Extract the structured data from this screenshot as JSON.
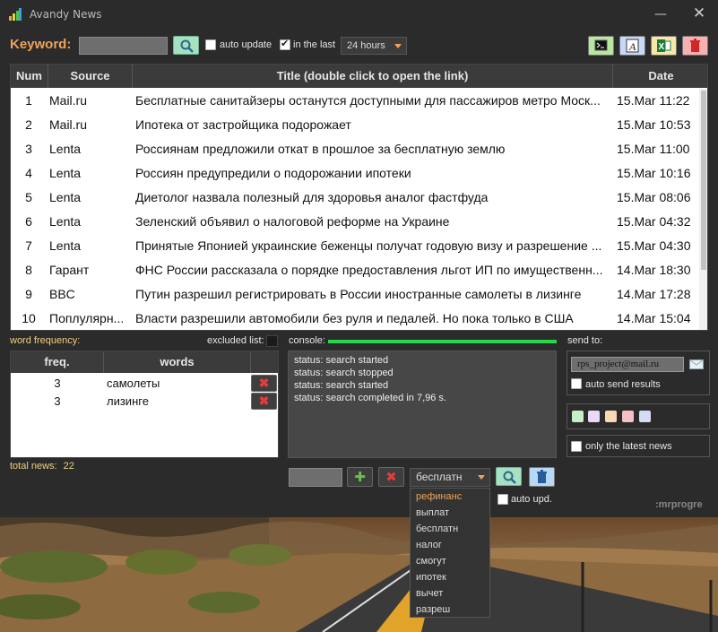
{
  "window": {
    "title": "Avandy News"
  },
  "toolbar": {
    "keyword_label": "Keyword:",
    "keyword_value": "",
    "auto_update_label": "auto update",
    "auto_update_checked": false,
    "in_last_label": "in the last",
    "in_last_checked": true,
    "period": "24 hours",
    "buttons": [
      "console-icon",
      "font-icon",
      "excel-icon",
      "trash-icon"
    ]
  },
  "news": {
    "columns": [
      "Num",
      "Source",
      "Title (double click to open the link)",
      "Date"
    ],
    "rows": [
      {
        "num": "1",
        "source": "Mail.ru",
        "title": "Бесплатные санитайзеры останутся доступными для пассажиров метро Моск...",
        "date": "15.Mar 11:22"
      },
      {
        "num": "2",
        "source": "Mail.ru",
        "title": "Ипотека от застройщика подорожает",
        "date": "15.Mar 10:53"
      },
      {
        "num": "3",
        "source": "Lenta",
        "title": "Россиянам предложили откат в прошлое за бесплатную землю",
        "date": "15.Mar 11:00"
      },
      {
        "num": "4",
        "source": "Lenta",
        "title": "Россиян предупредили о подорожании ипотеки",
        "date": "15.Mar 10:16"
      },
      {
        "num": "5",
        "source": "Lenta",
        "title": "Диетолог назвала полезный для здоровья аналог фастфуда",
        "date": "15.Mar 08:06"
      },
      {
        "num": "6",
        "source": "Lenta",
        "title": "Зеленский объявил о налоговой реформе на Украине",
        "date": "15.Mar 04:32"
      },
      {
        "num": "7",
        "source": "Lenta",
        "title": "Принятые Японией украинские беженцы получат годовую визу и разрешение ...",
        "date": "15.Mar 04:30"
      },
      {
        "num": "8",
        "source": "Гарант",
        "title": "ФНС России рассказала о порядке предоставления льгот ИП по имущественн...",
        "date": "14.Mar 18:30"
      },
      {
        "num": "9",
        "source": "BBC",
        "title": "Путин разрешил регистрировать в России иностранные самолеты в лизинге",
        "date": "14.Mar 17:28"
      },
      {
        "num": "10",
        "source": "Поплулярн...",
        "title": "Власти разрешили автомобили без руля и педалей. Но пока только в США",
        "date": "14.Mar 15:04"
      }
    ]
  },
  "word_frequency": {
    "label": "word frequency:",
    "excluded_label": "excluded list:",
    "columns": [
      "freq.",
      "words"
    ],
    "rows": [
      {
        "freq": "3",
        "word": "самолеты"
      },
      {
        "freq": "3",
        "word": "лизинге"
      }
    ],
    "total_label": "total news:",
    "total_value": "22"
  },
  "console": {
    "label": "console:",
    "lines": [
      "status: search started",
      "status: search stopped",
      "status: search started",
      "status: search completed in 7,96 s."
    ],
    "filter_value": "",
    "selected_word": "бесплатн",
    "word_options": [
      "рефинанс",
      "выплат",
      "бесплатн",
      "налог",
      "смогут",
      "ипотек",
      "вычет",
      "разреш"
    ],
    "auto_upd_label": "auto upd."
  },
  "send_to": {
    "label": "send to:",
    "email": "rps_project@mail.ru",
    "auto_send_label": "auto send results",
    "auto_send_checked": false,
    "color_swatches": [
      "#c6f0c6",
      "#ead8f6",
      "#f8d8b0",
      "#f6c0c8",
      "#d4dcf6"
    ],
    "latest_label": "only the latest news",
    "latest_checked": false
  },
  "brand": ":mrprogre",
  "colors": {
    "accent": "#f0a35a",
    "progress": "#27d84a",
    "label_yellow": "#f0d080"
  }
}
